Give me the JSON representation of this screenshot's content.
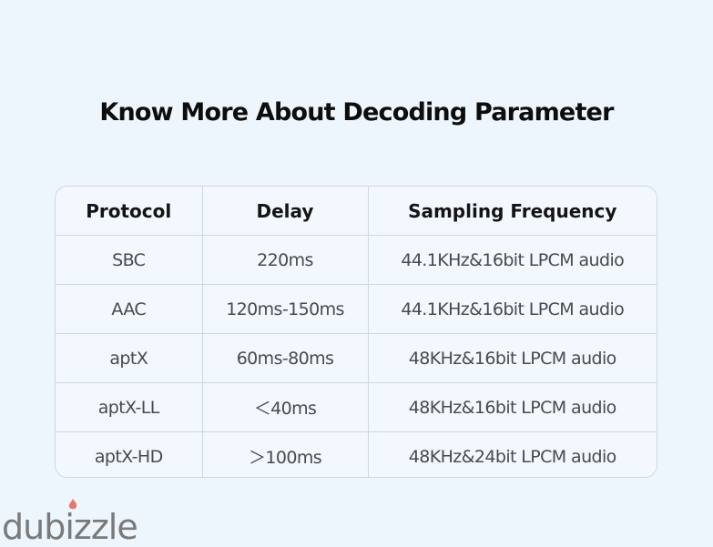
{
  "title": "Know More About Decoding Parameter",
  "table": {
    "headers": [
      "Protocol",
      "Delay",
      "Sampling Frequency"
    ],
    "rows": [
      [
        "SBC",
        "220ms",
        "44.1KHz&16bit LPCM audio"
      ],
      [
        "AAC",
        "120ms-150ms",
        "44.1KHz&16bit LPCM audio"
      ],
      [
        "aptX",
        "60ms-80ms",
        "48KHz&16bit LPCM audio"
      ],
      [
        "aptX-LL",
        "＜40ms",
        "48KHz&16bit LPCM audio"
      ],
      [
        "aptX-HD",
        "＞100ms",
        "48KHz&24bit LPCM audio"
      ]
    ]
  },
  "watermark": {
    "text": "dubizzle",
    "flame_color": "#e8786f"
  }
}
